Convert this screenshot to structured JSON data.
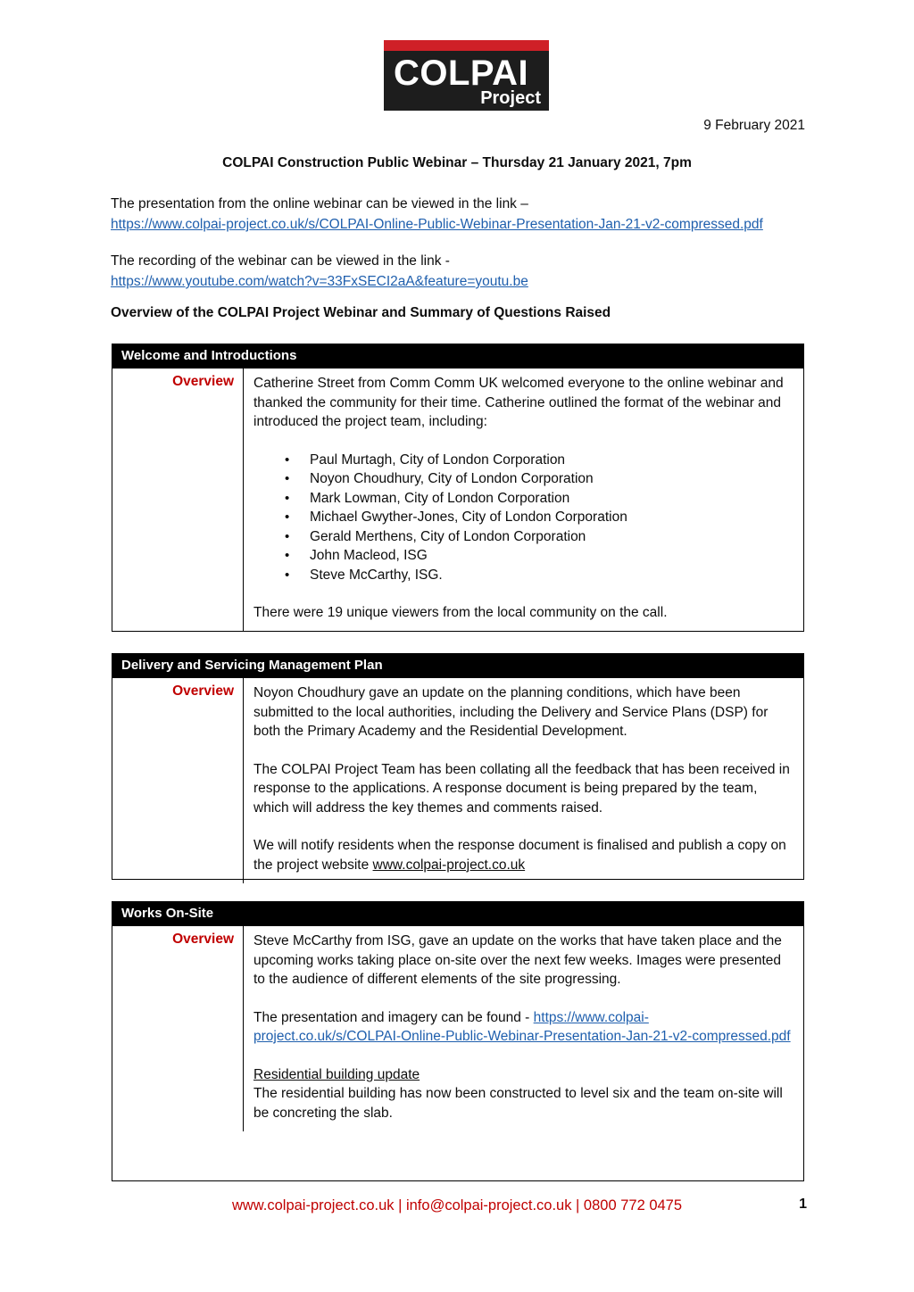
{
  "logo": {
    "main_text": "COLPAI",
    "sub_text": "Project",
    "red_bar_color": "#cf2027",
    "black_color": "#1d1d1d"
  },
  "header": {
    "date": "9 February 2021",
    "title": "COLPAI Construction Public Webinar – Thursday 21 January 2021, 7pm"
  },
  "intro": {
    "presentation_lead": "The presentation from the online webinar can be viewed in the link –",
    "presentation_link": "https://www.colpai-project.co.uk/s/COLPAI-Online-Public-Webinar-Presentation-Jan-21-v2-compressed.pdf",
    "recording_lead": "The recording of the webinar can be viewed in the link -",
    "recording_link": "https://www.youtube.com/watch?v=33FxSECI2aA&feature=youtu.be",
    "section_heading": "Overview of the COLPAI Project Webinar and Summary of Questions Raised"
  },
  "sections": [
    {
      "heading": "Welcome and Introductions",
      "label": "Overview",
      "paragraph_1": "Catherine Street from Comm Comm UK welcomed everyone to the online webinar and thanked the community for their time. Catherine outlined the format of the webinar and introduced the project team, including:",
      "bullets": [
        "Paul Murtagh, City of London Corporation",
        "Noyon Choudhury, City of London Corporation",
        "Mark Lowman, City of London Corporation",
        "Michael Gwyther-Jones, City of London Corporation",
        "Gerald Merthens, City of London Corporation",
        "John Macleod, ISG",
        "Steve McCarthy, ISG."
      ],
      "paragraph_2": "There were 19 unique viewers from the local community on the call."
    },
    {
      "heading": "Delivery and Servicing Management Plan",
      "label": "Overview",
      "paragraph_1": "Noyon Choudhury gave an update on the planning conditions, which have been submitted to the local authorities, including the Delivery and Service Plans (DSP) for both the Primary Academy and the Residential Development.",
      "paragraph_2": "The COLPAI Project Team has been collating all the feedback that has been received in response to the applications. A response document is being prepared by the team, which will address the key themes and comments raised.",
      "paragraph_3_lead": "We will notify residents when the response document is finalised and publish a copy on the project website ",
      "paragraph_3_link": "www.colpai-project.co.uk"
    },
    {
      "heading": "Works On-Site",
      "label": "Overview",
      "paragraph_1": "Steve McCarthy from ISG, gave an update on the works that have taken place and the upcoming works taking place on-site over the next few weeks. Images were presented to the audience of different elements of the site progressing.",
      "paragraph_2_lead": "The presentation and imagery can be found - ",
      "paragraph_2_link": "https://www.colpai-project.co.uk/s/COLPAI-Online-Public-Webinar-Presentation-Jan-21-v2-compressed.pdf",
      "subheading": "Residential building update",
      "paragraph_3": "The residential building has now been constructed to level six and the team on-site will be concreting the slab."
    }
  ],
  "footer": {
    "contact": "www.colpai-project.co.uk | info@colpai-project.co.uk | 0800 772 0475",
    "page_number": "1",
    "color": "#c00000"
  }
}
